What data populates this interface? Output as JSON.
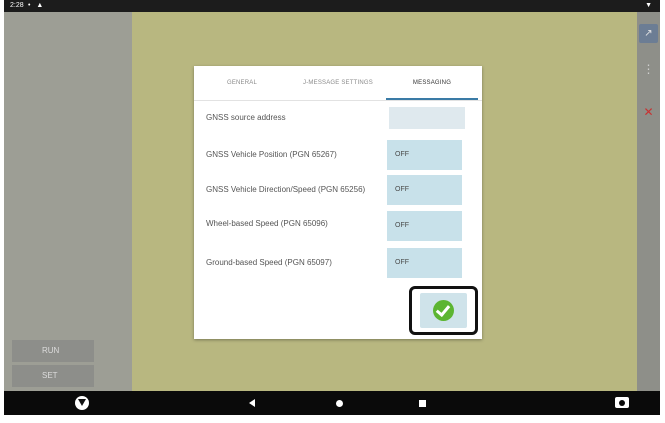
{
  "status_bar": {
    "time": "2:28",
    "icons": "• ▲",
    "wifi": "▼"
  },
  "side_buttons": [
    {
      "label": "RUN"
    },
    {
      "label": "SET"
    }
  ],
  "right_toolbar": {
    "top_icon": "↗",
    "menu_icon": "⋮",
    "tool_icon": "✕"
  },
  "dialog": {
    "tabs": [
      {
        "label": "GENERAL",
        "active": false
      },
      {
        "label": "J-MESSAGE SETTINGS",
        "active": false
      },
      {
        "label": "MESSAGING",
        "active": true
      }
    ],
    "rows": [
      {
        "label": "GNSS source address",
        "value": "",
        "disabled": true
      },
      {
        "label": "GNSS Vehicle Position (PGN 65267)",
        "value": "OFF",
        "disabled": false
      },
      {
        "label": "GNSS Vehicle Direction/Speed (PGN 65256)",
        "value": "OFF",
        "disabled": false
      },
      {
        "label": "Wheel-based Speed (PGN 65096)",
        "value": "OFF",
        "disabled": false
      },
      {
        "label": "Ground-based Speed (PGN 65097)",
        "value": "OFF",
        "disabled": false
      }
    ],
    "confirm_icon": "check-icon"
  },
  "nav_bar": {
    "logo_icon": "device-logo-icon",
    "back_icon": "back-icon",
    "home_icon": "home-icon",
    "recent_icon": "recent-apps-icon",
    "camera_icon": "camera-icon"
  }
}
